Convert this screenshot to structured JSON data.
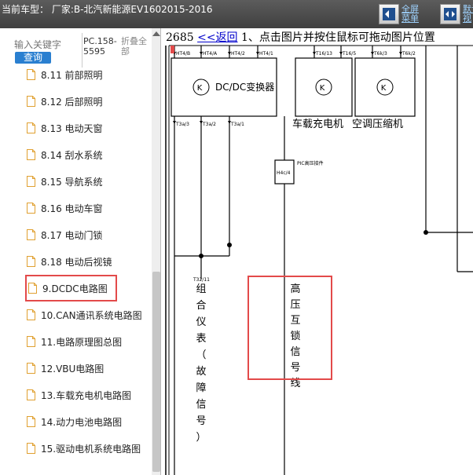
{
  "header": {
    "title": "当前车型： 厂家:B-北汽新能源EV1602015-2016",
    "fullscreen_label": "全屏菜单",
    "default_view_label": "默认视"
  },
  "sidebar": {
    "search_placeholder": "输入关键字",
    "search_button": "查询",
    "pc_label": "PC.158-5595",
    "collapse_label": "折叠全部",
    "items": [
      {
        "label": "8.11 前部照明"
      },
      {
        "label": "8.12 后部照明"
      },
      {
        "label": "8.13 电动天窗"
      },
      {
        "label": "8.14 刮水系统"
      },
      {
        "label": "8.15 导航系统"
      },
      {
        "label": "8.16 电动车窗"
      },
      {
        "label": "8.17 电动门锁"
      },
      {
        "label": "8.18 电动后视镜"
      },
      {
        "label": "9.DCDC电路图"
      },
      {
        "label": "10.CAN通讯系统电路图"
      },
      {
        "label": "11.电路原理图总图"
      },
      {
        "label": "12.VBU电路图"
      },
      {
        "label": "13.车载充电机电路图"
      },
      {
        "label": "14.动力电池电路图"
      },
      {
        "label": "15.驱动电机系统电路图"
      }
    ]
  },
  "main": {
    "counter": "2685",
    "back_link": "<<返回",
    "hint": "1、点击图片并按住鼠标可拖动图片位置"
  },
  "diagram": {
    "dcdc_label": "DC/DC变换器",
    "charger_label": "车载充电机",
    "ac_label": "空调压缩机",
    "instrument_label": "组合仪表（故障信号）",
    "interlock_label": "高压互锁信号线",
    "pins": {
      "ht4b": "HT4/B",
      "ht4a": "HT4/A",
      "ht42": "HT4/2",
      "ht41": "HT4/1",
      "t3a3": "T3a/3",
      "t3a2": "T3a/2",
      "t3a1": "T3a/1",
      "t1613": "T16/13",
      "t165": "T16/5",
      "t6k3": "T6k/3",
      "t6k2": "T6k/2",
      "t3211": "T32/11",
      "h4c4": "H4c/4",
      "pic": "PIC高压接件"
    },
    "colors": {
      "highlight": "#e34a4a",
      "wire": "#000000"
    }
  }
}
